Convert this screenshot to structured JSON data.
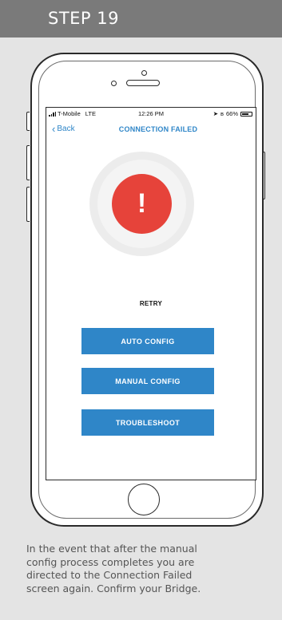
{
  "header": {
    "step_label": "STEP 19"
  },
  "status_bar": {
    "carrier": "T-Mobile",
    "network": "LTE",
    "time": "12:26 PM",
    "battery": "66%"
  },
  "nav": {
    "back_label": "Back",
    "title": "CONNECTION FAILED"
  },
  "alert": {
    "glyph": "!"
  },
  "actions": {
    "retry_label": "RETRY",
    "buttons": [
      {
        "label": "AUTO CONFIG"
      },
      {
        "label": "MANUAL CONFIG"
      },
      {
        "label": "TROUBLESHOOT"
      }
    ]
  },
  "caption": {
    "lines": [
      "In the event that after the manual",
      "config process completes you are",
      "directed to the Connection Failed",
      "screen again.  Confirm your Bridge."
    ]
  },
  "colors": {
    "accent": "#2f86c8",
    "alert": "#e6433a",
    "header_bg": "#7a7a7a",
    "panel_bg": "#e4e4e4"
  }
}
